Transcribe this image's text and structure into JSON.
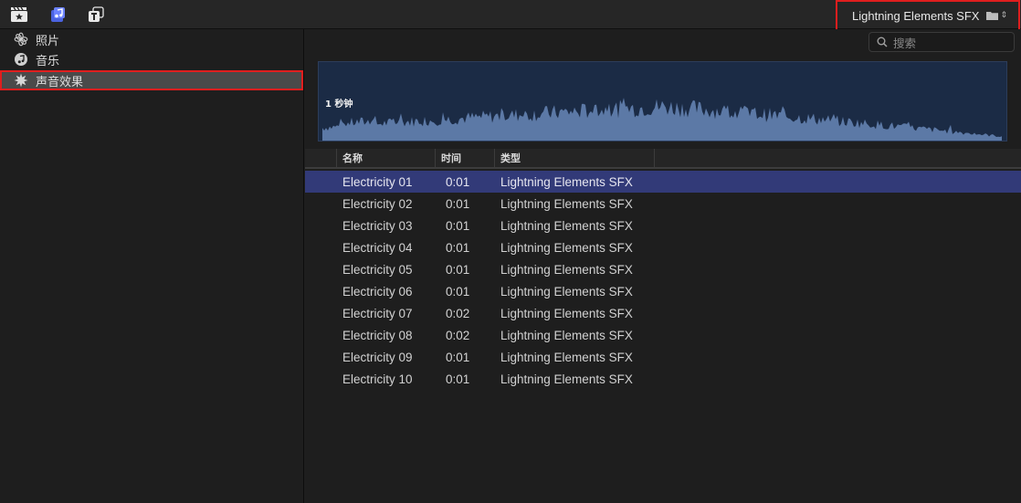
{
  "toolbar": {
    "icons": [
      "media-browser-icon",
      "music-note-icon",
      "titles-icon"
    ],
    "source_label": "Lightning Elements SFX",
    "source_icon": "folder-icon"
  },
  "sidebar": {
    "items": [
      {
        "label": "照片",
        "icon": "photos-icon",
        "selected": false
      },
      {
        "label": "音乐",
        "icon": "music-icon",
        "selected": false
      },
      {
        "label": "声音效果",
        "icon": "sound-effects-icon",
        "selected": true
      }
    ]
  },
  "search": {
    "placeholder": "搜索"
  },
  "waveform": {
    "duration_label": "1 秒钟"
  },
  "table": {
    "columns": [
      "名称",
      "时间",
      "类型"
    ],
    "rows": [
      {
        "name": "Electricity 01",
        "time": "0:01",
        "type": "Lightning Elements SFX",
        "selected": true
      },
      {
        "name": "Electricity 02",
        "time": "0:01",
        "type": "Lightning Elements SFX",
        "selected": false
      },
      {
        "name": "Electricity 03",
        "time": "0:01",
        "type": "Lightning Elements SFX",
        "selected": false
      },
      {
        "name": "Electricity 04",
        "time": "0:01",
        "type": "Lightning Elements SFX",
        "selected": false
      },
      {
        "name": "Electricity 05",
        "time": "0:01",
        "type": "Lightning Elements SFX",
        "selected": false
      },
      {
        "name": "Electricity 06",
        "time": "0:01",
        "type": "Lightning Elements SFX",
        "selected": false
      },
      {
        "name": "Electricity 07",
        "time": "0:02",
        "type": "Lightning Elements SFX",
        "selected": false
      },
      {
        "name": "Electricity 08",
        "time": "0:02",
        "type": "Lightning Elements SFX",
        "selected": false
      },
      {
        "name": "Electricity 09",
        "time": "0:01",
        "type": "Lightning Elements SFX",
        "selected": false
      },
      {
        "name": "Electricity 10",
        "time": "0:01",
        "type": "Lightning Elements SFX",
        "selected": false
      }
    ]
  },
  "colors": {
    "selection": "#323a78",
    "highlight_border": "#e01e1e",
    "waveform_fill": "#5c79a6",
    "accent_icon": "#4b63e0"
  }
}
